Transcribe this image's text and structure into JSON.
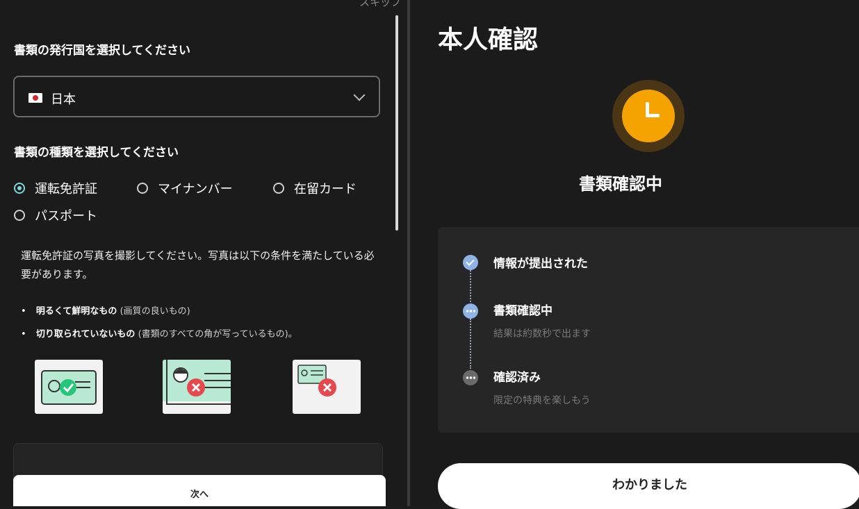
{
  "left": {
    "skip_label": "スキップ",
    "country_title": "書類の発行国を選択してください",
    "country": {
      "flag_icon": "japan-flag-icon",
      "value": "日本"
    },
    "doc_type_title": "書類の種類を選択してください",
    "doc_types": [
      {
        "label": "運転免許証",
        "checked": true
      },
      {
        "label": "マイナンバー",
        "checked": false
      },
      {
        "label": "在留カード",
        "checked": false
      },
      {
        "label": "パスポート",
        "checked": false
      }
    ],
    "instruction": "運転免許証の写真を撮影してください。写真は以下の条件を満たしている必要があります。",
    "requirements": [
      {
        "main": "明るくて鮮明なもの",
        "sub": "(画質の良いもの)"
      },
      {
        "main": "切り取られていないもの",
        "sub": "(書類のすべての角が写っているもの)。"
      }
    ],
    "samples": [
      {
        "name": "good-sample",
        "status": "ok"
      },
      {
        "name": "cropped-sample",
        "status": "ng"
      },
      {
        "name": "dark-sample",
        "status": "ng"
      }
    ],
    "next_label": "次へ"
  },
  "right": {
    "title": "本人確認",
    "status_icon": "clock-icon",
    "status_title": "書類確認中",
    "steps": [
      {
        "label": "情報が提出された",
        "sub": "",
        "state": "done"
      },
      {
        "label": "書類確認中",
        "sub": "結果は約数秒で出ます",
        "state": "in-progress"
      },
      {
        "label": "確認済み",
        "sub": "限定の特典を楽しもう",
        "state": "pending"
      }
    ],
    "ok_label": "わかりました"
  },
  "colors": {
    "background": "#1c1c1c",
    "accent_orange": "#f5a300",
    "radio_active": "#7ed6d6",
    "step_active": "#8fb3e6",
    "ok_icon": "#27c57a",
    "ng_icon": "#e5484d"
  }
}
